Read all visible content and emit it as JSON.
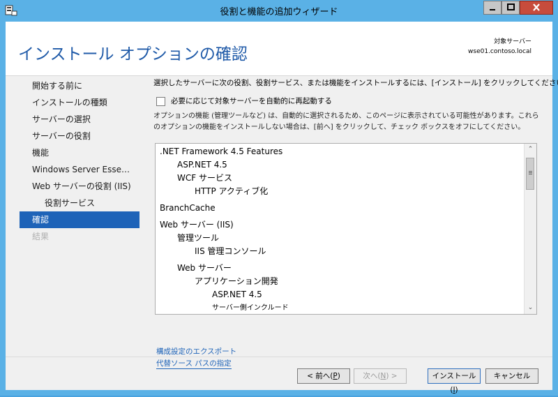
{
  "window": {
    "title": "役割と機能の追加ウィザード"
  },
  "header": {
    "page_title": "インストール オプションの確認",
    "server_label": "対象サーバー",
    "server_name": "wse01.contoso.local"
  },
  "nav": {
    "items": [
      {
        "label": "開始する前に",
        "state": "normal"
      },
      {
        "label": "インストールの種類",
        "state": "normal"
      },
      {
        "label": "サーバーの選択",
        "state": "normal"
      },
      {
        "label": "サーバーの役割",
        "state": "normal"
      },
      {
        "label": "機能",
        "state": "normal"
      },
      {
        "label": "Windows Server Esse…",
        "state": "normal"
      },
      {
        "label": "Web サーバーの役割 (IIS)",
        "state": "normal"
      },
      {
        "label": "役割サービス",
        "state": "sub"
      },
      {
        "label": "確認",
        "state": "active"
      },
      {
        "label": "結果",
        "state": "disabled"
      }
    ]
  },
  "main": {
    "intro_text": "選択したサーバーに次の役割、役割サービス、または機能をインストールするには、[インストール] をクリックしてください。",
    "restart_checkbox_label": "必要に応じて対象サーバーを自動的に再起動する",
    "optional_text": "オプションの機能 (管理ツールなど) は、自動的に選択されるため、このページに表示されている可能性があります。これらのオプションの機能をインストールしない場合は、[前へ] をクリックして、チェック ボックスをオフにしてください。",
    "features": [
      {
        "text": ".NET Framework 4.5 Features",
        "level": 0
      },
      {
        "text": "ASP.NET 4.5",
        "level": 1
      },
      {
        "text": "WCF サービス",
        "level": 1
      },
      {
        "text": "HTTP アクティブ化",
        "level": 2
      },
      {
        "text": "BranchCache",
        "level": 0
      },
      {
        "text": "Web サーバー (IIS)",
        "level": 0
      },
      {
        "text": "管理ツール",
        "level": 1
      },
      {
        "text": "IIS 管理コンソール",
        "level": 2
      },
      {
        "text": "Web サーバー",
        "level": 1
      },
      {
        "text": "アプリケーション開発",
        "level": 2
      },
      {
        "text": "ASP.NET 4.5",
        "level": 3
      },
      {
        "text": "サーバー側インクルード",
        "level": 3
      }
    ],
    "link_export": "構成設定のエクスポート",
    "link_source": "代替ソース パスの指定"
  },
  "buttons": {
    "prev": "< 前へ(",
    "prev_key": "P",
    "prev_end": ")",
    "next": "次へ(",
    "next_key": "N",
    "next_end": ") >",
    "install": "インストール(",
    "install_key": "I",
    "install_end": ")",
    "cancel": "キャンセル"
  }
}
